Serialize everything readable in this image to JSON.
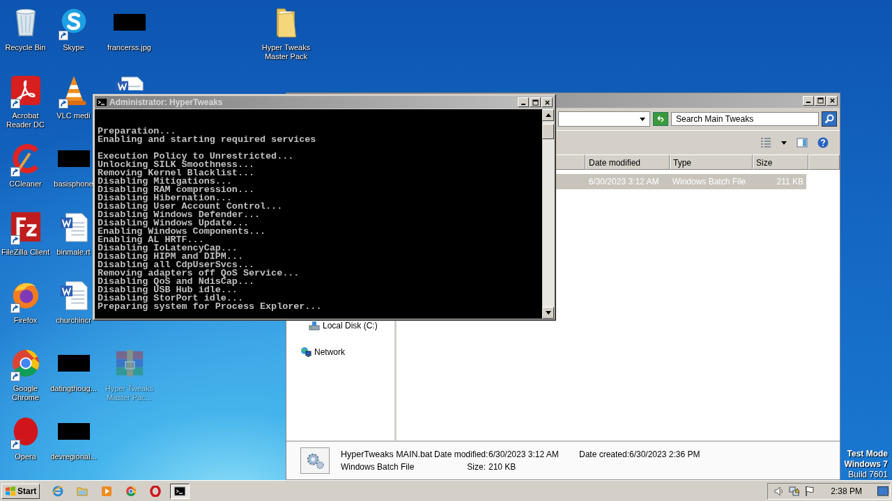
{
  "desktop": {
    "icons": [
      {
        "label": "Recycle Bin",
        "kind": "recycle-bin",
        "shortcut": false,
        "hidden": false
      },
      {
        "label": "Skype",
        "kind": "skype",
        "shortcut": true,
        "hidden": false
      },
      {
        "label": "francerss.jpg",
        "kind": "redacted",
        "shortcut": false,
        "hidden": false
      },
      {
        "label": "Hyper Tweaks Master Pack",
        "kind": "folder",
        "shortcut": false,
        "hidden": false
      },
      {
        "label": "Acrobat Reader DC",
        "kind": "acrobat",
        "shortcut": true,
        "hidden": false
      },
      {
        "label": "VLC medi",
        "kind": "vlc",
        "shortcut": true,
        "hidden": false
      },
      {
        "kind": "word",
        "shortcut": false,
        "hidden": false
      },
      {
        "label": "CCleaner",
        "kind": "ccleaner",
        "shortcut": true,
        "hidden": false
      },
      {
        "label": "basisphone",
        "kind": "redacted",
        "shortcut": false,
        "hidden": false
      },
      {
        "label": "FileZilla Client",
        "kind": "filezilla",
        "shortcut": true,
        "hidden": false
      },
      {
        "label": "binmale.rt",
        "kind": "word",
        "shortcut": false,
        "hidden": false
      },
      {
        "label": "Firefox",
        "kind": "firefox",
        "shortcut": true,
        "hidden": false
      },
      {
        "label": "churchincr",
        "kind": "word",
        "shortcut": false,
        "hidden": false
      },
      {
        "label": "Google Chrome",
        "kind": "chrome",
        "shortcut": true,
        "hidden": false
      },
      {
        "label": "datingthoug...",
        "kind": "redacted",
        "shortcut": false,
        "hidden": false
      },
      {
        "label": "Hyper Tweaks Master Pac...",
        "kind": "winrar",
        "shortcut": false,
        "hidden": true
      },
      {
        "label": "Opera",
        "kind": "opera",
        "shortcut": true,
        "hidden": false
      },
      {
        "label": "devregional...",
        "kind": "redacted",
        "shortcut": false,
        "hidden": false
      }
    ],
    "test_mode": [
      {
        "text": "Test Mode",
        "bold": true
      },
      {
        "text": "Windows 7",
        "bold": true
      },
      {
        "text": "Build 7601",
        "bold": false
      }
    ]
  },
  "explorer_window": {
    "search": {
      "placeholder": "Search Main Tweaks"
    },
    "columns": [
      "Date modified",
      "Type",
      "Size"
    ],
    "rows": [
      {
        "date_modified": "6/30/2023 3:12 AM",
        "type": "Windows Batch File",
        "size": "211 KB",
        "selected": true
      }
    ],
    "nav_items": [
      {
        "label": "Local Disk (C:)",
        "kind": "drive"
      },
      {
        "label": "Network",
        "kind": "network"
      }
    ],
    "details": {
      "name": "HyperTweaks MAIN.bat",
      "type": "Windows Batch File",
      "fields": [
        {
          "label": "Date modified:",
          "value": "6/30/2023 3:12 AM"
        },
        {
          "label": "Size:",
          "value": "210 KB"
        },
        {
          "label": "Date created:",
          "value": "6/30/2023 2:36 PM"
        }
      ]
    }
  },
  "console_window": {
    "title": "Administrator: HyperTweaks",
    "blocks": [
      [
        "Preparation...",
        "Enabling and starting required services"
      ],
      [
        "Execution Policy to Unrestricted...",
        "Unlocking SILK Smoothness...",
        "Removing Kernel Blacklist...",
        "Disabling Mitigations...",
        "Disabling RAM compression...",
        "Disabling Hibernation...",
        "Disabling User Account Control...",
        "Disabling Windows Defender...",
        "Disabling Windows Update...",
        "Enabling Windows Components...",
        "Enabling AL HRTF...",
        "Disabling IoLatencyCap...",
        "Disabling HIPM and DIPM...",
        "Disabling all CdpUserSvcs...",
        "Removing adapters off QoS Service...",
        "Disabling QoS and NdisCap...",
        "Disabling USB Hub idle...",
        "Disabling StorPort idle...",
        "Preparing system for Process Explorer..."
      ]
    ]
  },
  "taskbar": {
    "start": "Start",
    "apps": [
      {
        "kind": "ie",
        "active": false
      },
      {
        "kind": "explorer",
        "active": false
      },
      {
        "kind": "media",
        "active": false
      },
      {
        "kind": "chrome",
        "active": false
      },
      {
        "kind": "opera",
        "active": false
      },
      {
        "kind": "cmd",
        "active": true
      }
    ],
    "clock": "2:38 PM"
  }
}
